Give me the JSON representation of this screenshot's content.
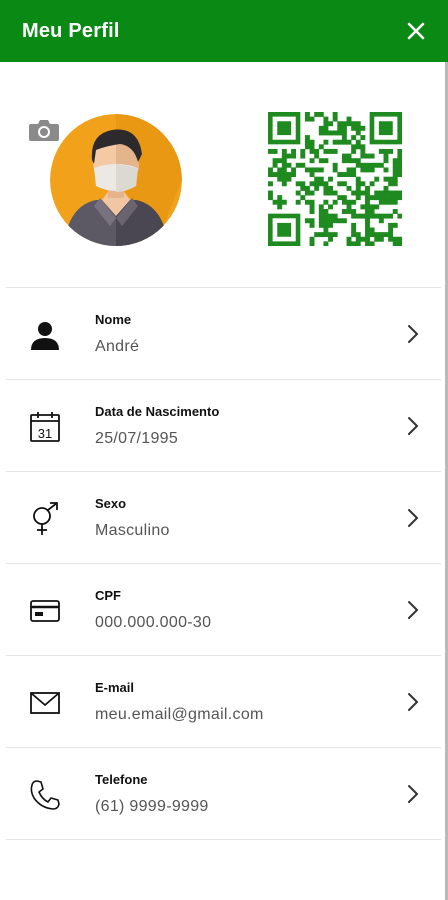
{
  "header": {
    "title": "Meu Perfil",
    "close_icon": "close-icon",
    "color": "#0a8a14"
  },
  "profile": {
    "camera_icon": "camera-icon",
    "avatar": "avatar-man-with-mask",
    "qr_code": "qr-code"
  },
  "fields": [
    {
      "label": "Nome",
      "value": "André",
      "icon": "person-icon"
    },
    {
      "label": "Data de Nascimento",
      "value": "25/07/1995",
      "icon": "calendar-icon",
      "icon_text": "31"
    },
    {
      "label": "Sexo",
      "value": "Masculino",
      "icon": "gender-icon"
    },
    {
      "label": "CPF",
      "value": "000.000.000-30",
      "icon": "card-icon"
    },
    {
      "label": "E-mail",
      "value": "meu.email@gmail.com",
      "icon": "mail-icon"
    },
    {
      "label": "Telefone",
      "value": "(61) 9999-9999",
      "icon": "phone-icon"
    }
  ]
}
